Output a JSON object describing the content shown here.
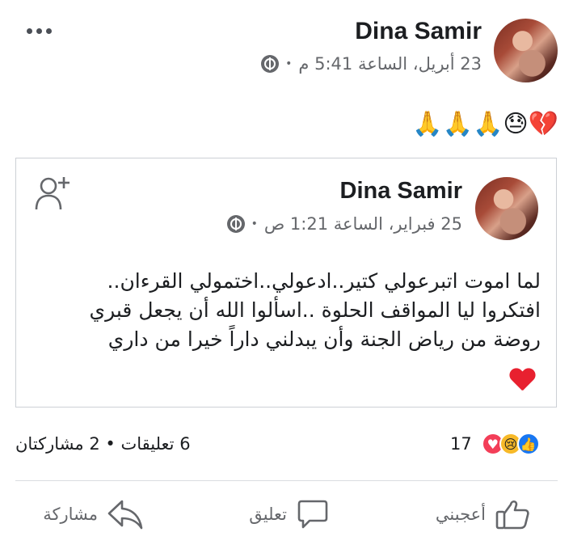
{
  "post": {
    "author": "Dina Samir",
    "timestamp": "23 أبريل، الساعة 5:41 م",
    "privacy_icon": "globe-icon",
    "content_emojis": "🙏🙏🙏😓💔"
  },
  "shared_post": {
    "author": "Dina Samir",
    "timestamp": "25 فبراير، الساعة 1:21 ص",
    "privacy_icon": "globe-icon",
    "text_lines": [
      "لما اموت اتبرعولي كتير..ادعولي..اختمولي القرءان..",
      "افتكروا ليا المواقف الحلوة ..اسألوا الله أن يجعل قبري",
      "روضة من رياض الجنة وأن يبدلني داراً خيرا من داري"
    ],
    "heart_emoji": "❤️"
  },
  "reactions": {
    "count": "17",
    "icons": [
      "like-icon",
      "sad-icon",
      "love-icon"
    ]
  },
  "engagement": {
    "summary": "6 تعليقات • 2 مشاركتان"
  },
  "actions": {
    "like_label": "أعجبني",
    "comment_label": "تعليق",
    "share_label": "مشاركة"
  },
  "colors": {
    "like_blue": "#1877f2",
    "love_red": "#f33e58",
    "sad_yellow": "#f7b928",
    "meta_gray": "#65676b"
  }
}
